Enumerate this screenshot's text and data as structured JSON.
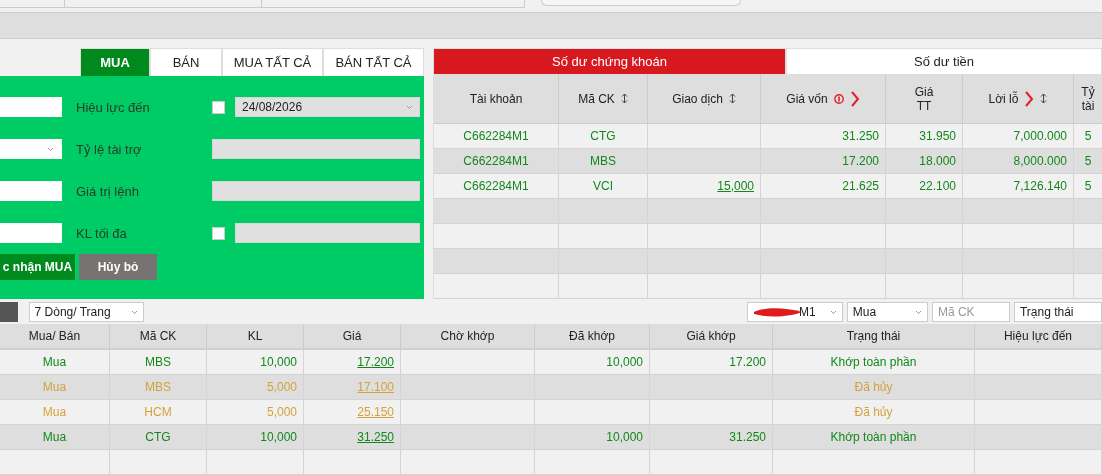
{
  "order_form": {
    "tabs": [
      {
        "label": "MUA",
        "selected": true
      },
      {
        "label": "BÁN",
        "selected": false
      },
      {
        "label": "MUA TẤT CẢ",
        "selected": false
      },
      {
        "label": "BÁN TẤT CẢ",
        "selected": false
      }
    ],
    "rows": [
      {
        "kind": "text",
        "label": "Hiệu lực đến",
        "checkbox": {
          "checked": false
        },
        "field": {
          "kind": "date",
          "value": "24/08/2026"
        }
      },
      {
        "kind": "select",
        "label": "Tỷ lệ tài trợ",
        "field": {
          "kind": "readonly"
        }
      },
      {
        "kind": "text",
        "label": "Giá trị lệnh",
        "field": {
          "kind": "readonly"
        }
      },
      {
        "kind": "text",
        "label": "KL tối đa",
        "checkbox": {
          "checked": false
        },
        "field": {
          "kind": "readonly"
        }
      }
    ],
    "confirm_button": "c nhận MUA",
    "cancel_button": "Hủy bỏ"
  },
  "holdings": {
    "tabs": [
      {
        "label": "Số dư chứng khoán",
        "selected": true
      },
      {
        "label": "Số dư tiền",
        "selected": false
      }
    ],
    "columns": [
      {
        "label": "Tài khoản",
        "sort": false,
        "info": false,
        "chevron": false
      },
      {
        "label": "Mã CK",
        "sort": true,
        "info": false,
        "chevron": false
      },
      {
        "label": "Giao dịch",
        "sort": true,
        "info": false,
        "chevron": false
      },
      {
        "label": "Giá vốn",
        "sort": false,
        "info": true,
        "chevron": true
      },
      {
        "label": "Giá TT",
        "sort": false,
        "info": false,
        "chevron": false
      },
      {
        "label": "Lời lỗ",
        "sort": true,
        "info": false,
        "chevron": true
      },
      {
        "label": "Tỷ tài",
        "sort": false,
        "info": false,
        "chevron": false
      }
    ],
    "rows": [
      {
        "account": "C662284M1",
        "symbol": "CTG",
        "cost": "31.250",
        "price": "31.950",
        "pnl": "7,000.000",
        "column_7": "5"
      },
      {
        "account": "C662284M1",
        "symbol": "MBS",
        "cost": "17.200",
        "price": "18.000",
        "pnl": "8,000.000",
        "column_7": "5"
      },
      {
        "account": "C662284M1",
        "symbol": "VCI",
        "trading": "15,000",
        "cost": "21.625",
        "price": "22.100",
        "pnl": "7,126.140",
        "column_7": "5"
      }
    ]
  },
  "orders": {
    "page_size": "7 Dòng/ Trang",
    "filters": {
      "account": "M1",
      "side": "Mua",
      "symbol_placeholder": "Mã CK",
      "status": "Trạng thái"
    },
    "columns": [
      "Mua/ Bán",
      "Mã CK",
      "KL",
      "Giá",
      "Chờ khớp",
      "Đã khớp",
      "Giá khớp",
      "Trạng thái",
      "Hiệu lực đến"
    ],
    "rows": [
      {
        "kind": "matched",
        "side": "Mua",
        "symbol": "MBS",
        "qty": "10,000",
        "price": "17.200",
        "matched": "10,000",
        "match_price": "17.200",
        "status": "Khớp toàn phần"
      },
      {
        "kind": "cancelled",
        "side": "Mua",
        "symbol": "MBS",
        "qty": "5,000",
        "price": "17.100",
        "status": "Đã hủy"
      },
      {
        "kind": "cancelled",
        "side": "Mua",
        "symbol": "HCM",
        "qty": "5,000",
        "price": "25.150",
        "status": "Đã hủy"
      },
      {
        "kind": "matched",
        "side": "Mua",
        "symbol": "CTG",
        "qty": "10,000",
        "price": "31.250",
        "matched": "10,000",
        "match_price": "31.250",
        "status": "Khớp toàn phần"
      }
    ]
  }
}
